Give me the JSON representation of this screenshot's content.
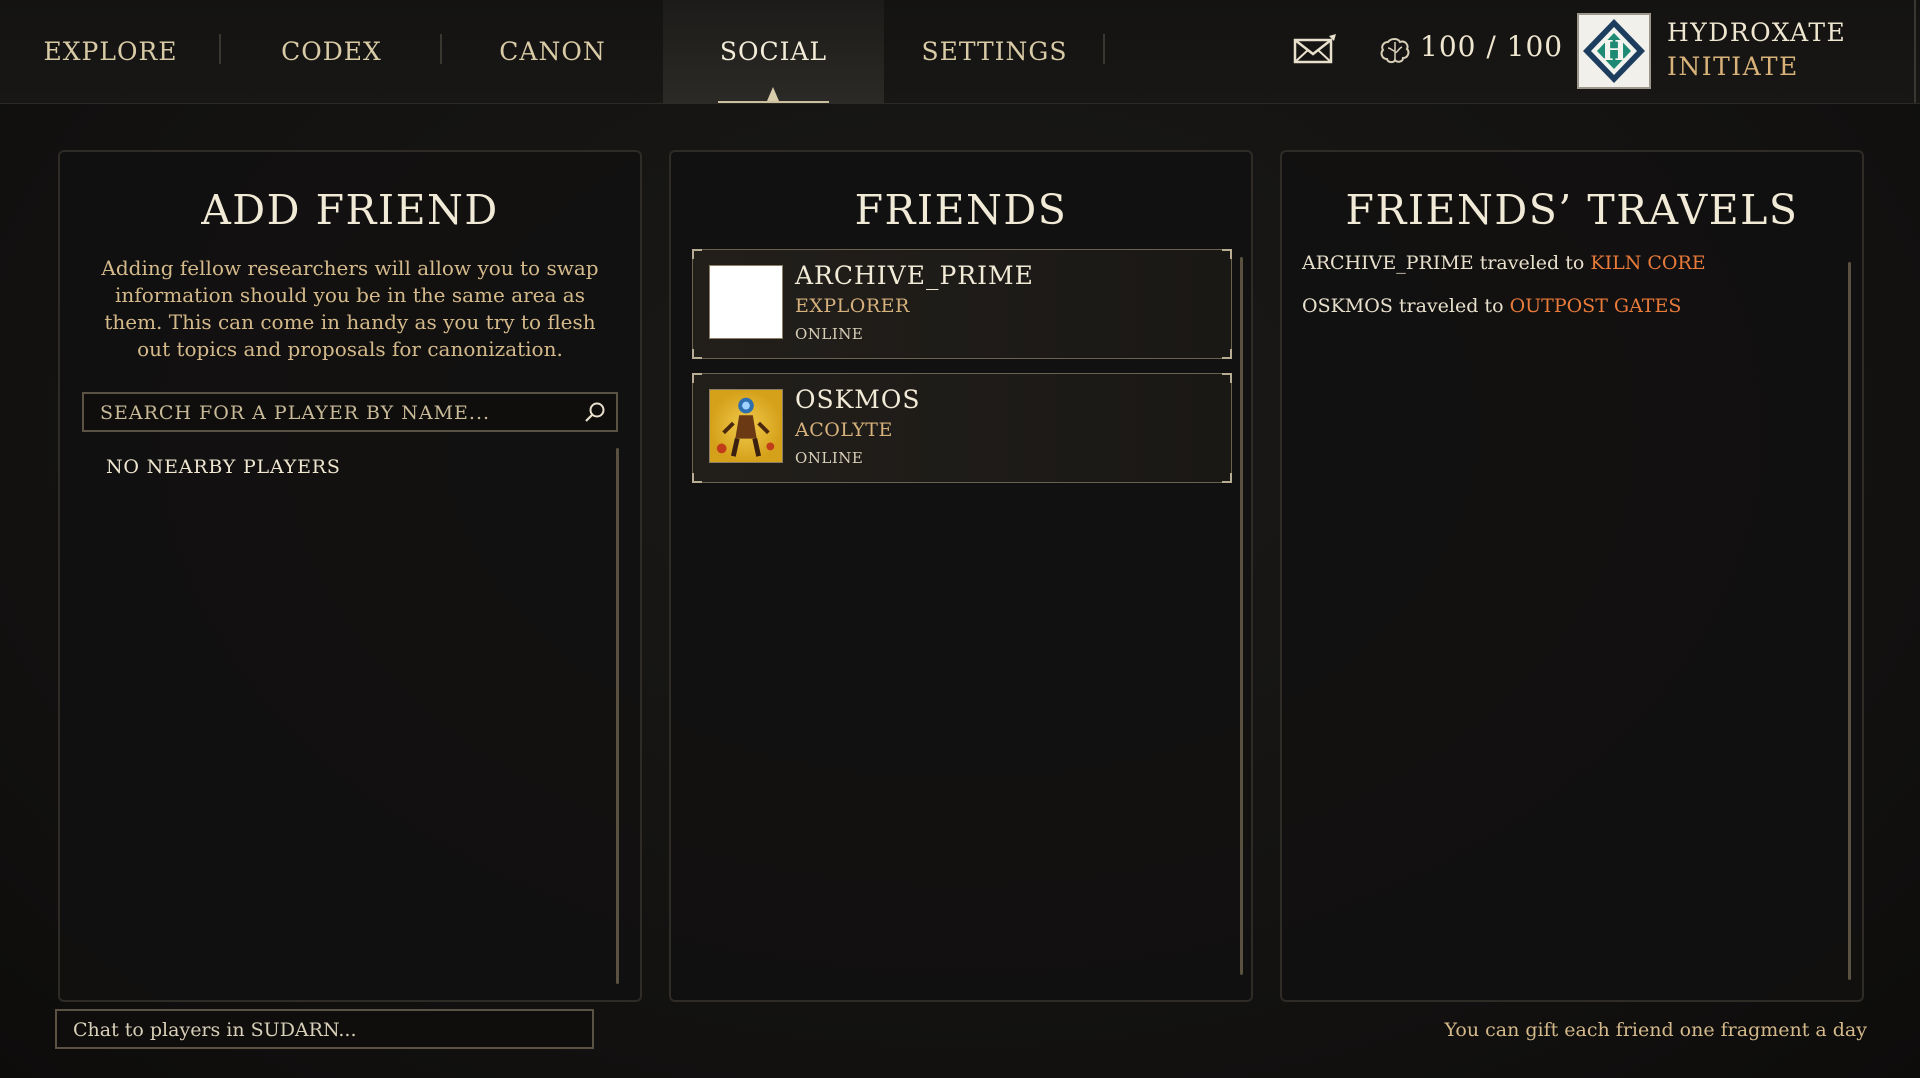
{
  "nav": {
    "tabs": [
      {
        "label": "EXPLORE",
        "active": false
      },
      {
        "label": "CODEX",
        "active": false
      },
      {
        "label": "CANON",
        "active": false
      },
      {
        "label": "SOCIAL",
        "active": true
      },
      {
        "label": "SETTINGS",
        "active": false
      }
    ],
    "icons": {
      "mail": "envelope-icon",
      "brain": "brain-icon",
      "emblem": "hydroxate-emblem"
    }
  },
  "energy": {
    "current": "100",
    "max": "100",
    "display": "100 / 100"
  },
  "rank": {
    "faction": "HYDROXATE",
    "title": "INITIATE"
  },
  "add_friend": {
    "title": "ADD FRIEND",
    "description": "Adding fellow researchers will allow you to swap information should you be in the same area as them. This can come in handy as you try to flesh out topics and proposals for canonization.",
    "search_placeholder": "SEARCH FOR A PLAYER BY NAME...",
    "empty_text": "NO NEARBY PLAYERS"
  },
  "friends": {
    "title": "FRIENDS",
    "list": [
      {
        "name": "ARCHIVE_PRIME",
        "rank": "EXPLORER",
        "status": "ONLINE",
        "avatar": "blank"
      },
      {
        "name": "OSKMOS",
        "rank": "ACOLYTE",
        "status": "ONLINE",
        "avatar": "character-art"
      }
    ]
  },
  "travels": {
    "title": "FRIENDS’ TRAVELS",
    "entries": [
      {
        "player": "ARCHIVE_PRIME",
        "verb": "traveled to",
        "destination": "KILN CORE"
      },
      {
        "player": "OSKMOS",
        "verb": "traveled to",
        "destination": "OUTPOST GATES"
      }
    ]
  },
  "chat": {
    "placeholder": "Chat to players in SUDARN..."
  },
  "footer": {
    "gift_note": "You can gift each friend one fragment a day"
  },
  "colors": {
    "accent_gold": "#d6b17c",
    "destination": "#e87a3a",
    "text": "#efe6d0",
    "background": "#131211"
  }
}
